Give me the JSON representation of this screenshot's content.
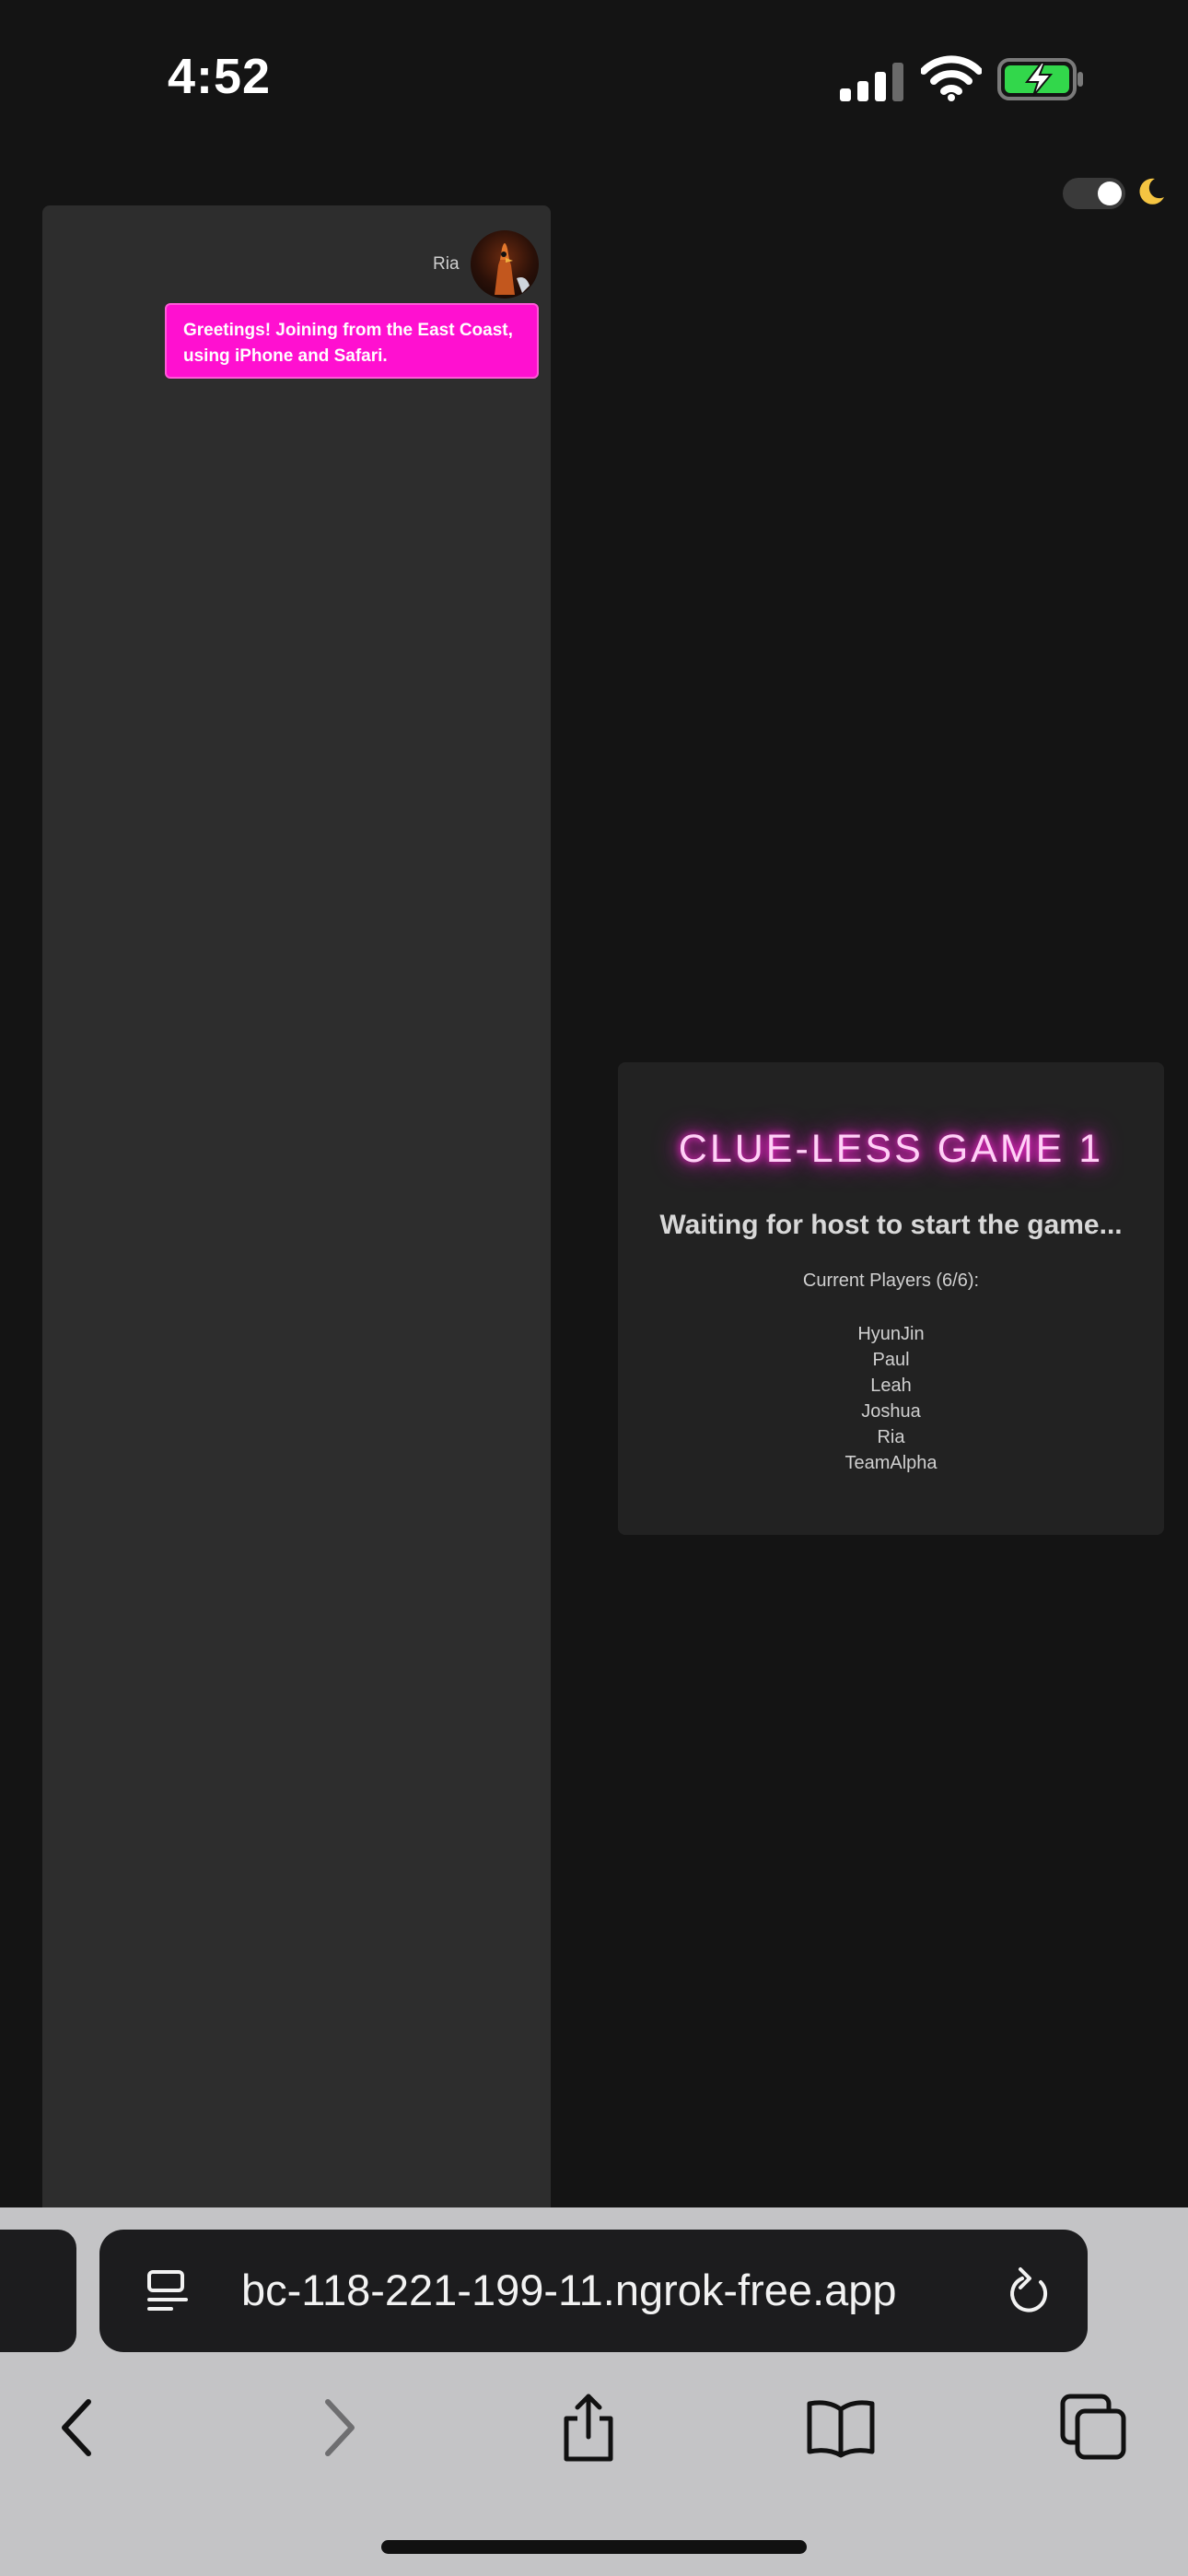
{
  "status_bar": {
    "time": "4:52",
    "icons": [
      "signal-icon",
      "wifi-icon",
      "battery-charging-icon"
    ],
    "battery_color": "#32d74b"
  },
  "theme_toggle": {
    "state": "on",
    "icon": "moon-icon"
  },
  "chat": {
    "messages": [
      {
        "sender": "Ria",
        "text": "Greetings! Joining from the East Coast, using iPhone and Safari.",
        "bubble_color": "#ff10d0"
      }
    ]
  },
  "lobby": {
    "title": "CLUE-LESS GAME 1",
    "status": "Waiting for host to start the game...",
    "players_heading": "Current Players (6/6):",
    "players": [
      "HyunJin",
      "Paul",
      "Leah",
      "Joshua",
      "Ria",
      "TeamAlpha"
    ],
    "accent_color": "#ff2ad6"
  },
  "browser": {
    "url": "bc-118-221-199-11.ngrok-free.app",
    "toolbar_icons": [
      "back-icon",
      "forward-icon",
      "share-icon",
      "bookmarks-icon",
      "tabs-icon"
    ]
  }
}
